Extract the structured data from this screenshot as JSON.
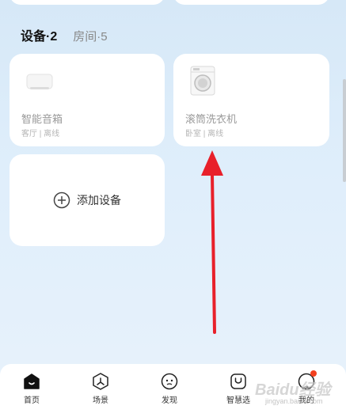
{
  "tabs": [
    {
      "label": "设备·2",
      "active": true
    },
    {
      "label": "房间·5",
      "active": false
    }
  ],
  "devices": [
    {
      "name": "智能音箱",
      "room": "客厅",
      "status": "离线",
      "icon": "smart-speaker-icon"
    },
    {
      "name": "滚筒洗衣机",
      "room": "卧室",
      "status": "离线",
      "icon": "washing-machine-icon"
    }
  ],
  "status_separator": " | ",
  "add_device": {
    "label": "添加设备",
    "icon": "plus-circle-icon"
  },
  "annotation": {
    "color": "#e8202a",
    "icon": "red-arrow-up"
  },
  "nav": [
    {
      "label": "首页",
      "icon": "home-icon",
      "active": true
    },
    {
      "label": "场景",
      "icon": "scene-icon",
      "active": false
    },
    {
      "label": "发现",
      "icon": "discover-icon",
      "active": false
    },
    {
      "label": "智慧选",
      "icon": "smart-select-icon",
      "active": false
    },
    {
      "label": "我的",
      "icon": "profile-icon",
      "active": false,
      "badge": true
    }
  ],
  "watermark": {
    "brand": "Baidu经验",
    "url": "jingyan.baidu.com"
  },
  "colors": {
    "badge": "#f2401f",
    "inactive_text": "#999999"
  }
}
